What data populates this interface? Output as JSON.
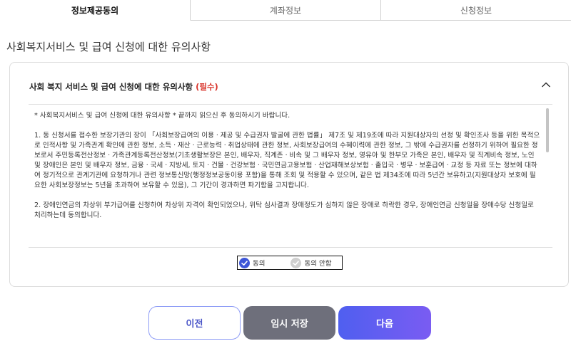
{
  "tabs": [
    {
      "label": "정보제공동의",
      "active": true
    },
    {
      "label": "계좌정보",
      "active": false
    },
    {
      "label": "신청정보",
      "active": false
    }
  ],
  "page_title": "사회복지서비스 및 급여 신청에 대한 유의사항",
  "card": {
    "heading": "사회 복지 서비스 및 급여 신청에 대한 유의사항",
    "required_label": "(필수)",
    "notice": "* 사회복지서비스 및 급여 신청에 대한 유의사항 * 끝까지 읽으신 후 동의하시기 바랍니다.",
    "paragraphs": [
      "1. 동 신청서를 접수한 보장기관의 장이 「사회보장급여의 이용ㆍ제공 및 수급권자 발굴에 관한 법률」 제7조 및 제19조에 따라 지원대상자의 선정 및 확인조사 등을 위한 목적으로 인적사항 및 가족관계 확인에 관한 정보, 소득ㆍ재산ㆍ근로능력ㆍ취업상태에 관한 정보, 사회보장급여의 수혜이력에 관한 정보, 그 밖에 수급권자를 선정하기 위하여 필요한 정보로서 주민등록전산정보ㆍ가족관계등록전산정보(기초생활보장은 본인, 배우자, 직계존ㆍ비속 및 그 배우자 정보, 영유아 및 한부모 가족은 본인, 배우자 및 직계비속 정보, 노인 및 장애인은 본인 및 배우자 정보, 금융ㆍ국세ㆍ지방세, 토지ㆍ건물ㆍ건강보험ㆍ국민연금고용보험ㆍ산업재해보상보험ㆍ출입국ㆍ병무ㆍ보훈급여ㆍ교정 등 자료 또는 정보에 대하여 정기적으로 관계기관에 요청하거나 관련 정보통신망(행정정보공동이용 포함)을 통해 조회 및 적용할 수 있으며, 같은 법 제34조에 따라 5년간 보유하고(지원대상자 보호에 필요한 사회보장정보는 5년을 초과하여 보유할 수 있음), 그 기간이 경과하면 파기함을 고지합니다.",
      "2. 장애인연금의 차상위 부가급여를 신청하여 차상위 자격이 확인되었으나, 위탁 심사결과 장애정도가 심하지 않은 장애로 하락한 경우, 장애인연금 신청일을 장애수당 신청일로 처리하는데 동의합니다."
    ]
  },
  "consent": {
    "agree_label": "동의",
    "disagree_label": "동의 안함",
    "selected": "agree"
  },
  "buttons": {
    "prev": "이전",
    "save": "임시 저장",
    "next": "다음"
  },
  "colors": {
    "accent": "#4f5ff0",
    "required": "#d9342b",
    "save_bg": "#6e6f7b"
  }
}
